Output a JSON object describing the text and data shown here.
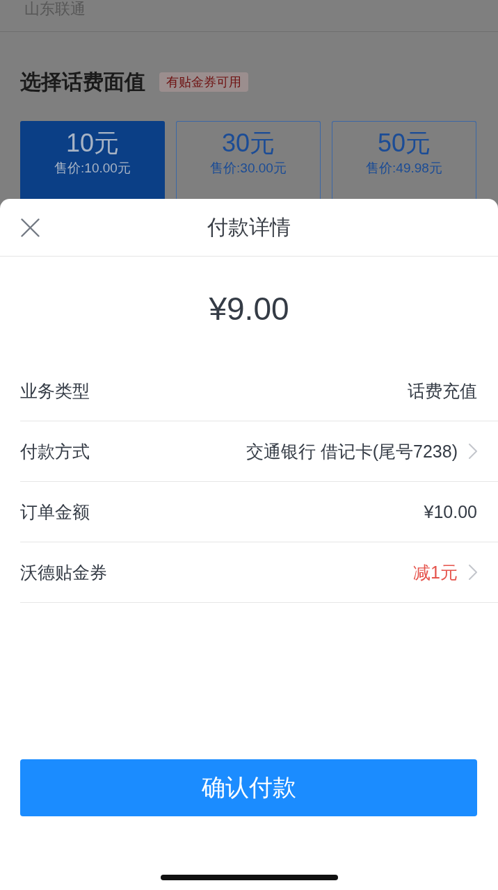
{
  "background_page": {
    "carrier": "山东联通",
    "section_title": "选择话费面值",
    "badge": "有贴金券可用",
    "denominations": [
      {
        "face_value": "10元",
        "price": "售价:10.00元",
        "selected": true
      },
      {
        "face_value": "30元",
        "price": "售价:30.00元",
        "selected": false
      },
      {
        "face_value": "50元",
        "price": "售价:49.98元",
        "selected": false
      }
    ]
  },
  "payment_sheet": {
    "title": "付款详情",
    "amount": "¥9.00",
    "details": [
      {
        "label": "业务类型",
        "value": "话费充值",
        "chevron": false,
        "highlight": false
      },
      {
        "label": "付款方式",
        "value": "交通银行 借记卡(尾号7238)",
        "chevron": true,
        "highlight": false
      },
      {
        "label": "订单金额",
        "value": "¥10.00",
        "chevron": false,
        "highlight": false
      },
      {
        "label": "沃德贴金券",
        "value": "减1元",
        "chevron": true,
        "highlight": true
      }
    ],
    "confirm_button": "确认付款"
  }
}
